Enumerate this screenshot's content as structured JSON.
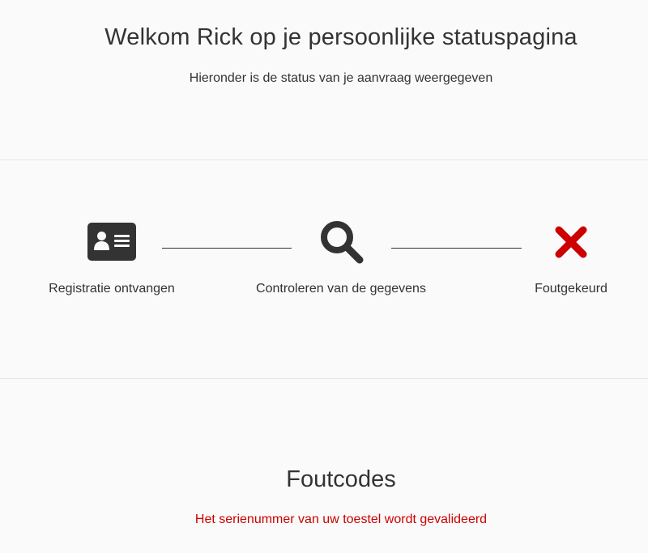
{
  "header": {
    "title": "Welkom Rick op je persoonlijke statuspagina",
    "subtitle": "Hieronder is de status van je aanvraag weergegeven"
  },
  "status_steps": [
    {
      "label": "Registratie ontvangen",
      "icon": "id-card-icon"
    },
    {
      "label": "Controleren van de gegevens",
      "icon": "search-icon"
    },
    {
      "label": "Foutgekeurd",
      "icon": "close-icon"
    }
  ],
  "error_section": {
    "title": "Foutcodes",
    "message": "Het serienummer van uw toestel wordt gevalideerd"
  },
  "colors": {
    "text": "#333333",
    "icon": "#333333",
    "error": "#cc0000",
    "background": "#fafafa",
    "divider": "#e6e6e6"
  }
}
